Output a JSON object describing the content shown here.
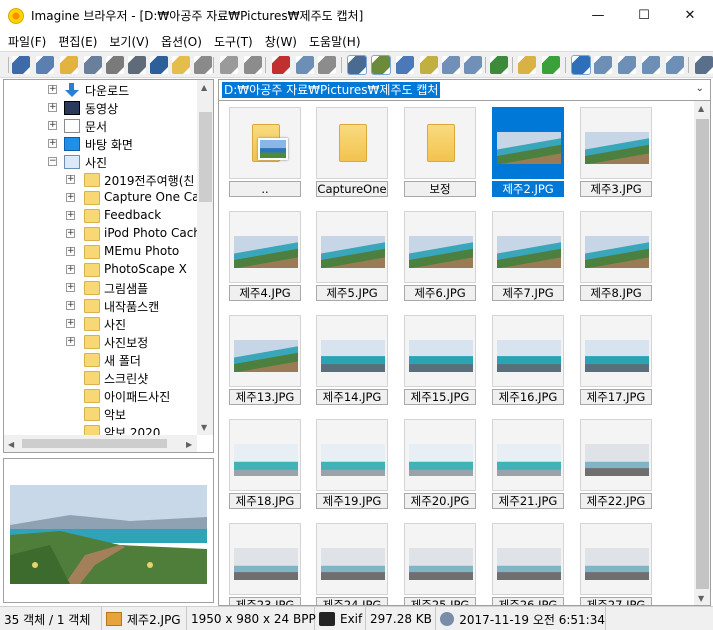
{
  "window": {
    "title": "Imagine 브라우저 - [D:₩아공주 자료₩Pictures₩제주도 캡처]",
    "minimize_glyph": "—",
    "maximize_glyph": "☐",
    "close_glyph": "✕"
  },
  "menu": [
    "파일(F)",
    "편집(E)",
    "보기(V)",
    "옵션(O)",
    "도구(T)",
    "창(W)",
    "도움말(H)"
  ],
  "toolbar": {
    "buttons": [
      {
        "icon": "eye-icon",
        "color": "#3d6aa8"
      },
      {
        "icon": "view-window-icon",
        "color": "#5a7fb0"
      },
      {
        "icon": "open-folder-icon",
        "color": "#e2b33f"
      },
      {
        "icon": "save-icon",
        "color": "#6a7f9a"
      },
      {
        "icon": "print-icon",
        "color": "#7a7a7a"
      },
      {
        "icon": "scan-icon",
        "color": "#5f6b78"
      },
      {
        "icon": "info-icon",
        "color": "#2d5f99"
      },
      {
        "icon": "new-folder-icon",
        "color": "#e5bd4a"
      },
      {
        "icon": "rename-icon",
        "color": "#8a8a8a"
      },
      {
        "icon": "clipboard-icon",
        "color": "#9a9a9a"
      },
      {
        "icon": "settings-icon",
        "color": "#8c8c8c"
      },
      {
        "icon": "cut-icon",
        "color": "#c03030"
      },
      {
        "icon": "copy-icon",
        "color": "#6d8fb5"
      },
      {
        "icon": "paste-icon",
        "color": "#8c8c8c"
      },
      {
        "icon": "filmstrip-icon",
        "color": "#4a6a92",
        "active": true
      },
      {
        "icon": "sort-icon",
        "color": "#6b8a3a",
        "active": true
      },
      {
        "icon": "timer-icon",
        "color": "#4a78b8"
      },
      {
        "icon": "tag-icon",
        "color": "#c0b040"
      },
      {
        "icon": "grid-icon",
        "color": "#7090b8"
      },
      {
        "icon": "list-icon",
        "color": "#7090b8"
      },
      {
        "icon": "slideshow-icon",
        "color": "#3d8a3d"
      },
      {
        "icon": "up-folder-icon",
        "color": "#d8b243"
      },
      {
        "icon": "refresh-icon",
        "color": "#3aa03a"
      },
      {
        "icon": "thumbnails-view-icon",
        "color": "#2f6fb8",
        "active": true
      },
      {
        "icon": "large-icons-view-icon",
        "color": "#6d8fb5"
      },
      {
        "icon": "small-icons-view-icon",
        "color": "#6d8fb5"
      },
      {
        "icon": "details-view-icon",
        "color": "#6d8fb5"
      },
      {
        "icon": "columns-view-icon",
        "color": "#6d8fb5"
      },
      {
        "icon": "tools-icon",
        "color": "#5a6f8a"
      }
    ]
  },
  "tree": {
    "items": [
      {
        "label": "다운로드",
        "icon": "download-icon"
      },
      {
        "label": "동영상",
        "icon": "video-icon"
      },
      {
        "label": "문서",
        "icon": "document-icon"
      },
      {
        "label": "바탕 화면",
        "icon": "desktop-icon"
      },
      {
        "label": "사진",
        "icon": "pictures-icon",
        "expanded": true
      },
      {
        "label": "2019전주여행(친",
        "icon": "folder-icon"
      },
      {
        "label": "Capture One Cata",
        "icon": "folder-icon"
      },
      {
        "label": "Feedback",
        "icon": "folder-icon"
      },
      {
        "label": "iPod Photo Cach",
        "icon": "folder-icon"
      },
      {
        "label": "MEmu Photo",
        "icon": "folder-icon"
      },
      {
        "label": "PhotoScape X",
        "icon": "folder-icon"
      },
      {
        "label": "그림샘플",
        "icon": "folder-icon"
      },
      {
        "label": "내작품스캔",
        "icon": "folder-icon"
      },
      {
        "label": "사진",
        "icon": "folder-icon"
      },
      {
        "label": "사진보정",
        "icon": "folder-icon"
      },
      {
        "label": "새 폴더",
        "icon": "folder-icon"
      },
      {
        "label": "스크린샷",
        "icon": "folder-icon"
      },
      {
        "label": "아이패드사진",
        "icon": "folder-icon"
      },
      {
        "label": "악보",
        "icon": "folder-icon"
      },
      {
        "label": "악보 2020",
        "icon": "folder-icon"
      }
    ]
  },
  "path_bar": {
    "value": "D:₩아공주 자료₩Pictures₩제주도 캡처",
    "arrow": "⌄"
  },
  "thumbnails": [
    {
      "label": "..",
      "kind": "parent"
    },
    {
      "label": "CaptureOne",
      "kind": "folder"
    },
    {
      "label": "보정",
      "kind": "folder"
    },
    {
      "label": "제주2.JPG",
      "kind": "image",
      "selected": true,
      "pic": 0
    },
    {
      "label": "제주3.JPG",
      "kind": "image",
      "pic": 0
    },
    {
      "label": "제주4.JPG",
      "kind": "image",
      "pic": 0
    },
    {
      "label": "제주5.JPG",
      "kind": "image",
      "pic": 0
    },
    {
      "label": "제주6.JPG",
      "kind": "image",
      "pic": 0
    },
    {
      "label": "제주7.JPG",
      "kind": "image",
      "pic": 0
    },
    {
      "label": "제주8.JPG",
      "kind": "image",
      "pic": 0
    },
    {
      "label": "제주13.JPG",
      "kind": "image",
      "pic": 0
    },
    {
      "label": "제주14.JPG",
      "kind": "image",
      "pic": 1
    },
    {
      "label": "제주15.JPG",
      "kind": "image",
      "pic": 1
    },
    {
      "label": "제주16.JPG",
      "kind": "image",
      "pic": 1
    },
    {
      "label": "제주17.JPG",
      "kind": "image",
      "pic": 1
    },
    {
      "label": "제주18.JPG",
      "kind": "image",
      "pic": 2
    },
    {
      "label": "제주19.JPG",
      "kind": "image",
      "pic": 2
    },
    {
      "label": "제주20.JPG",
      "kind": "image",
      "pic": 2
    },
    {
      "label": "제주21.JPG",
      "kind": "image",
      "pic": 2
    },
    {
      "label": "제주22.JPG",
      "kind": "image",
      "pic": 3
    },
    {
      "label": "제주23.JPG",
      "kind": "image",
      "pic": 3
    },
    {
      "label": "제주24.JPG",
      "kind": "image",
      "pic": 3
    },
    {
      "label": "제주25.JPG",
      "kind": "image",
      "pic": 3
    },
    {
      "label": "제주26.JPG",
      "kind": "image",
      "pic": 3
    },
    {
      "label": "제주27.JPG",
      "kind": "image",
      "pic": 3
    }
  ],
  "status": {
    "count": "35 객체 / 1 객체",
    "file": "제주2.JPG",
    "dimensions": "1950 x 980 x 24 BPP",
    "exif": "Exif",
    "size": "297.28 KB",
    "date": "2017-11-19 오전 6:51:34"
  }
}
